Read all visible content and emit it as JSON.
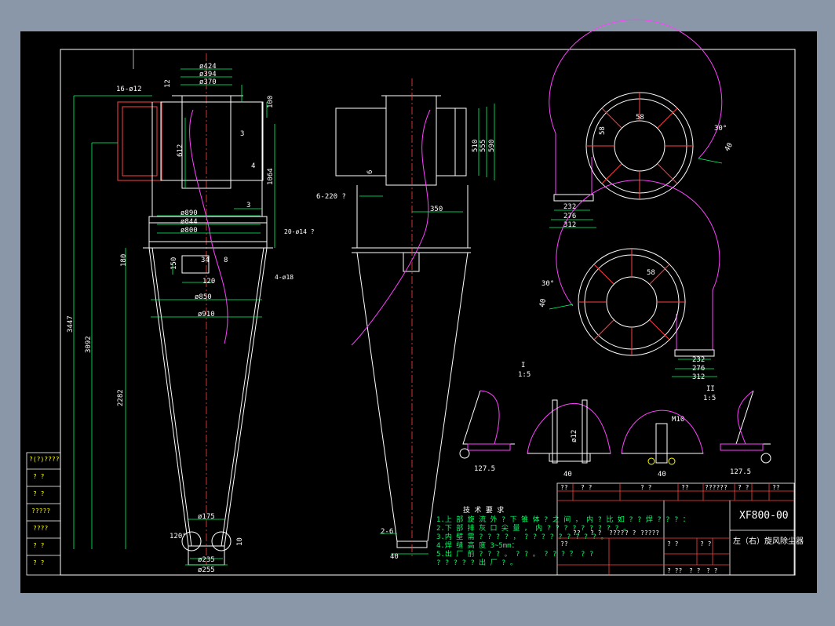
{
  "dims": {
    "top": [
      "ø424",
      "ø394",
      "ø370"
    ],
    "flange_holes": "16-ø12",
    "d_890": "ø890",
    "d_844": "ø844",
    "d_800": "ø800",
    "holes_20": "20-ø14 ?",
    "d_850": "ø850",
    "d_910": "ø910",
    "holes_4": "4-ø18",
    "d_175": "ø175",
    "d_235": "ø235",
    "d_255": "ø255",
    "h_3447": "3447",
    "h_3092": "3092",
    "h_2282": "2282",
    "h_612": "612",
    "h_1064": "1064",
    "h_100": "100",
    "h_180": "180",
    "h_150": "150",
    "w_120": "120",
    "v_34": "34",
    "v_8": "8",
    "v_12": "12",
    "v_3": "3",
    "v_4": "4",
    "v_10": "10",
    "a_120": "120°",
    "holes_6": "6-220 ?",
    "d_350": "350",
    "h_510": "510",
    "h_555": "555",
    "h_590": "590",
    "v_6": "6",
    "b_2_6": "2-6",
    "b_40": "40",
    "r_58": "58",
    "w_232": "232",
    "w_276": "276",
    "w_312": "312",
    "ang_30": "30°",
    "v_40": "40",
    "scale_i": "I",
    "scale_ii": "II",
    "scale_15": "1:5",
    "d_1275": "127.5",
    "m10": "M10",
    "dø12": "ø12"
  },
  "notes": {
    "title": "技 术 要 求",
    "lines": [
      "1.上 部 旋 流 外 ? 下 锥 体 ? 之 间 ， 内 ? 比 如 ? ? 焊 ? ? ? ：",
      "2.下 部 排 灰 口 尖 量 ， 内 ? ? ? ? ? ? ? ? ? 。",
      "3.内 壁 需 ? ? ? ? ， ? ? ? ? ? ? ? ? ? 。",
      "4.焊 缝 高 度 3~5mm：",
      "5.出 厂 前 ? ? ? 。 ? ? 。 ? ? ? ？ ? ?",
      "? ? ? ? ? 出 厂 ? 。"
    ]
  },
  "left_table": [
    "?(?)????",
    "?  ?",
    "?  ?",
    "?????",
    "????",
    "?  ?",
    "?  ?"
  ],
  "title_block": {
    "drawing_no": "XF800-00",
    "name": "左（右）旋风除尘器",
    "header": [
      "??",
      "?  ?",
      "?  ?",
      "??",
      "??????",
      "?  ?",
      "??"
    ],
    "row_cells": [
      "??",
      "??",
      "?  ?",
      "????",
      "?  ?",
      "?????"
    ],
    "bottom": [
      "?  ??",
      "?  ?",
      "?  ?",
      "?  ?",
      "?  ?"
    ]
  }
}
